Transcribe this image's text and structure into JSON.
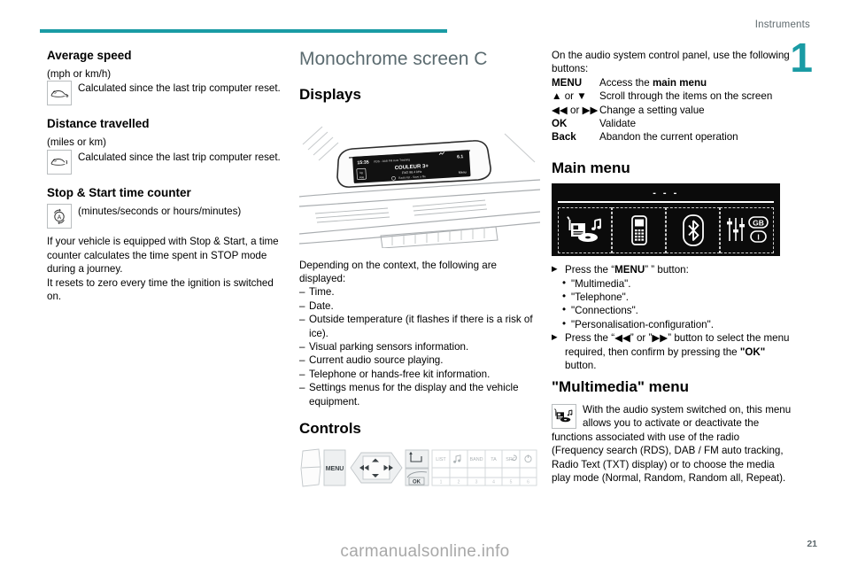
{
  "header": {
    "section_label": "Instruments",
    "chapter_number": "1"
  },
  "column_left": {
    "blocks": [
      {
        "heading": "Average speed",
        "units": "(mph or km/h)",
        "icon": "car-average-speed-icon",
        "text": "Calculated since the last trip computer reset."
      },
      {
        "heading": "Distance travelled",
        "units": "(miles or km)",
        "icon": "car-distance-icon",
        "text": "Calculated since the last trip computer reset."
      },
      {
        "heading": "Stop & Start time counter",
        "icon": "stop-start-a-icon",
        "units": "(minutes/seconds or hours/minutes)",
        "paragraphs": [
          "If your vehicle is equipped with Stop & Start, a time counter calculates the time spent in STOP mode during a journey.",
          "It resets to zero every time the ignition is switched on."
        ]
      }
    ]
  },
  "column_middle": {
    "title": "Monochrome screen C",
    "displays_heading": "Displays",
    "dashboard_screen": {
      "time": "15:35",
      "station": "COULEUR 3+",
      "frequency": "FM2 98.4 kHz",
      "temperature": "6.1",
      "right_label": "Menu",
      "ticker": "RDS - DAB FM Auto Tracking"
    },
    "intro": "Depending on the context, the following are displayed:",
    "items": [
      "Time.",
      "Date.",
      "Outside temperature (it flashes if there is a risk of ice).",
      "Visual parking sensors information.",
      "Current audio source playing.",
      "Telephone or hands-free kit information.",
      "Settings menus for the display and the vehicle equipment."
    ],
    "controls_heading": "Controls",
    "panel_buttons": {
      "menu": "MENU",
      "ok": "OK",
      "list": "LIST",
      "note": "music-note-icon",
      "band": "BAND",
      "ta": "TA",
      "src": "SRC",
      "power": "power-icon",
      "presets": [
        "1",
        "2",
        "3",
        "4",
        "5",
        "6"
      ]
    }
  },
  "column_right": {
    "intro": "On the audio system control panel, use the following buttons:",
    "key_rows": [
      {
        "key": "MENU",
        "key_type": "text",
        "desc_pre": "Access the ",
        "desc_bold": "main menu",
        "desc_post": ""
      },
      {
        "key": "▲ or ▼",
        "key_type": "symbol",
        "desc_pre": "Scroll through the items on the screen",
        "desc_bold": "",
        "desc_post": ""
      },
      {
        "key": "◀◀ or ▶▶",
        "key_type": "symbol",
        "desc_pre": "Change a setting value",
        "desc_bold": "",
        "desc_post": ""
      },
      {
        "key": "OK",
        "key_type": "text",
        "desc_pre": "Validate",
        "desc_bold": "",
        "desc_post": ""
      },
      {
        "key": "Back",
        "key_type": "text",
        "desc_pre": "Abandon the current operation",
        "desc_bold": "",
        "desc_post": ""
      }
    ],
    "main_menu_heading": "Main menu",
    "main_menu_screen": {
      "top_dashes": "- - -",
      "tiles": [
        {
          "icon": "multimedia-radio-cd-icon",
          "label": "Multimedia"
        },
        {
          "icon": "telephone-handset-icon",
          "label": "Telephone"
        },
        {
          "icon": "bluetooth-icon",
          "label": "Connections"
        },
        {
          "icon": "settings-sliders-icon",
          "label": "Personalisation-configuration",
          "badges": [
            "GB",
            "I"
          ]
        }
      ]
    },
    "step_press_menu_pre": "Press the “",
    "step_press_menu_bold": "MENU",
    "step_press_menu_post": "” ” button:",
    "menu_options": [
      "\"Multimedia\".",
      "\"Telephone\".",
      "\"Connections\".",
      "\"Personalisation-configuration\"."
    ],
    "step_select_pre": "Press the “",
    "step_select_sym1": "◀◀",
    "step_select_mid": "” or ”",
    "step_select_sym2": "▶▶",
    "step_select_post": "” button to select the menu required, then confirm by pressing the ",
    "step_select_bold": "\"OK\"",
    "step_select_end": " button.",
    "multimedia_heading": "\"Multimedia\" menu",
    "multimedia_icon": "multimedia-radio-cd-icon",
    "multimedia_text": "With the audio system switched on, this menu allows you to activate or deactivate the functions associated with use of the radio (Frequency search (RDS), DAB / FM auto tracking, Radio Text (TXT) display) or to choose the media play mode (Normal, Random, Random all, Repeat)."
  },
  "footer": {
    "watermark": "carmanualsonline.info",
    "page_number": "21"
  },
  "colors": {
    "accent": "#1a9ba4",
    "heading_grey": "#5b6b70",
    "screen_black": "#0b0b0b"
  }
}
